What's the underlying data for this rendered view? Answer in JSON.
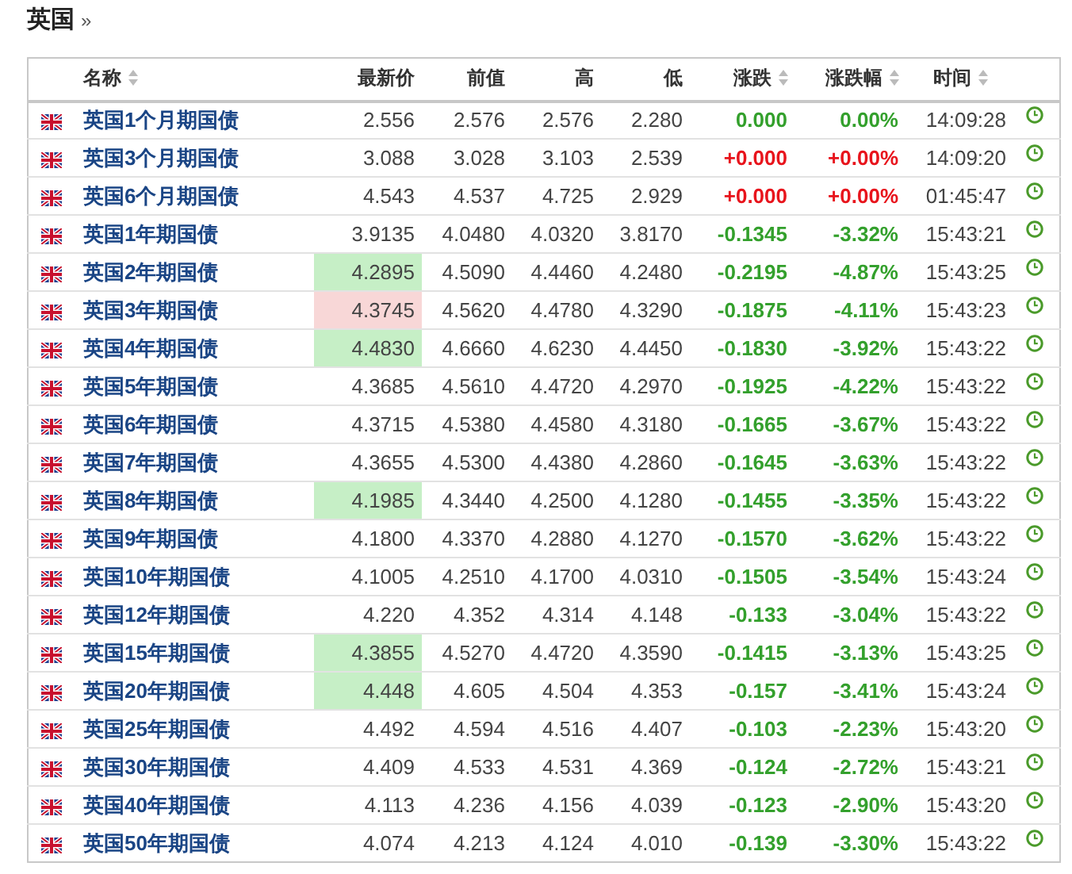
{
  "heading": {
    "title": "英国",
    "more": "»"
  },
  "table": {
    "columns": [
      {
        "label": "名称",
        "sortable": true
      },
      {
        "label": "最新价",
        "sortable": false
      },
      {
        "label": "前值",
        "sortable": false
      },
      {
        "label": "高",
        "sortable": false
      },
      {
        "label": "低",
        "sortable": false
      },
      {
        "label": "涨跌",
        "sortable": true
      },
      {
        "label": "涨跌幅",
        "sortable": true
      },
      {
        "label": "时间",
        "sortable": true
      }
    ],
    "rows": [
      {
        "name": "英国1个月期国债",
        "last": {
          "text": "2.556",
          "highlighted": false
        },
        "prev": "2.576",
        "high": "2.576",
        "low": "2.280",
        "change": "0.000",
        "change_pct": "0.00%",
        "time": "14:09:28",
        "color": "#33a02c"
      },
      {
        "name": "英国3个月期国债",
        "last": {
          "text": "3.088",
          "highlighted": false
        },
        "prev": "3.028",
        "high": "3.103",
        "low": "2.539",
        "change": "+0.000",
        "change_pct": "+0.00%",
        "time": "14:09:20",
        "color": "#e8141c"
      },
      {
        "name": "英国6个月期国债",
        "last": {
          "text": "4.543",
          "highlighted": false
        },
        "prev": "4.537",
        "high": "4.725",
        "low": "2.929",
        "change": "+0.000",
        "change_pct": "+0.00%",
        "time": "01:45:47",
        "color": "#e8141c"
      },
      {
        "name": "英国1年期国债",
        "last": {
          "text": "3.9135",
          "highlighted": false
        },
        "prev": "4.0480",
        "high": "4.0320",
        "low": "3.8170",
        "change": "-0.1345",
        "change_pct": "-3.32%",
        "time": "15:43:21",
        "color": "#33a02c"
      },
      {
        "name": "英国2年期国债",
        "last": {
          "text": "4.2895",
          "highlighted": true,
          "color": "#c6efc6"
        },
        "prev": "4.5090",
        "high": "4.4460",
        "low": "4.2480",
        "change": "-0.2195",
        "change_pct": "-4.87%",
        "time": "15:43:25",
        "color": "#33a02c"
      },
      {
        "name": "英国3年期国债",
        "last": {
          "text": "4.3745",
          "highlighted": true,
          "color": "#f8d7d7"
        },
        "prev": "4.5620",
        "high": "4.4780",
        "low": "4.3290",
        "change": "-0.1875",
        "change_pct": "-4.11%",
        "time": "15:43:23",
        "color": "#33a02c"
      },
      {
        "name": "英国4年期国债",
        "last": {
          "text": "4.4830",
          "highlighted": true,
          "color": "#c6efc6"
        },
        "prev": "4.6660",
        "high": "4.6230",
        "low": "4.4450",
        "change": "-0.1830",
        "change_pct": "-3.92%",
        "time": "15:43:22",
        "color": "#33a02c"
      },
      {
        "name": "英国5年期国债",
        "last": {
          "text": "4.3685",
          "highlighted": false
        },
        "prev": "4.5610",
        "high": "4.4720",
        "low": "4.2970",
        "change": "-0.1925",
        "change_pct": "-4.22%",
        "time": "15:43:22",
        "color": "#33a02c"
      },
      {
        "name": "英国6年期国债",
        "last": {
          "text": "4.3715",
          "highlighted": false
        },
        "prev": "4.5380",
        "high": "4.4580",
        "low": "4.3180",
        "change": "-0.1665",
        "change_pct": "-3.67%",
        "time": "15:43:22",
        "color": "#33a02c"
      },
      {
        "name": "英国7年期国债",
        "last": {
          "text": "4.3655",
          "highlighted": false
        },
        "prev": "4.5300",
        "high": "4.4380",
        "low": "4.2860",
        "change": "-0.1645",
        "change_pct": "-3.63%",
        "time": "15:43:22",
        "color": "#33a02c"
      },
      {
        "name": "英国8年期国债",
        "last": {
          "text": "4.1985",
          "highlighted": true,
          "color": "#c6efc6"
        },
        "prev": "4.3440",
        "high": "4.2500",
        "low": "4.1280",
        "change": "-0.1455",
        "change_pct": "-3.35%",
        "time": "15:43:22",
        "color": "#33a02c"
      },
      {
        "name": "英国9年期国债",
        "last": {
          "text": "4.1800",
          "highlighted": false
        },
        "prev": "4.3370",
        "high": "4.2880",
        "low": "4.1270",
        "change": "-0.1570",
        "change_pct": "-3.62%",
        "time": "15:43:22",
        "color": "#33a02c"
      },
      {
        "name": "英国10年期国债",
        "last": {
          "text": "4.1005",
          "highlighted": false
        },
        "prev": "4.2510",
        "high": "4.1700",
        "low": "4.0310",
        "change": "-0.1505",
        "change_pct": "-3.54%",
        "time": "15:43:24",
        "color": "#33a02c"
      },
      {
        "name": "英国12年期国债",
        "last": {
          "text": "4.220",
          "highlighted": false
        },
        "prev": "4.352",
        "high": "4.314",
        "low": "4.148",
        "change": "-0.133",
        "change_pct": "-3.04%",
        "time": "15:43:22",
        "color": "#33a02c"
      },
      {
        "name": "英国15年期国债",
        "last": {
          "text": "4.3855",
          "highlighted": true,
          "color": "#c6efc6"
        },
        "prev": "4.5270",
        "high": "4.4720",
        "low": "4.3590",
        "change": "-0.1415",
        "change_pct": "-3.13%",
        "time": "15:43:25",
        "color": "#33a02c"
      },
      {
        "name": "英国20年期国债",
        "last": {
          "text": "4.448",
          "highlighted": true,
          "color": "#c6efc6"
        },
        "prev": "4.605",
        "high": "4.504",
        "low": "4.353",
        "change": "-0.157",
        "change_pct": "-3.41%",
        "time": "15:43:24",
        "color": "#33a02c"
      },
      {
        "name": "英国25年期国债",
        "last": {
          "text": "4.492",
          "highlighted": false
        },
        "prev": "4.594",
        "high": "4.516",
        "low": "4.407",
        "change": "-0.103",
        "change_pct": "-2.23%",
        "time": "15:43:20",
        "color": "#33a02c"
      },
      {
        "name": "英国30年期国债",
        "last": {
          "text": "4.409",
          "highlighted": false
        },
        "prev": "4.533",
        "high": "4.531",
        "low": "4.369",
        "change": "-0.124",
        "change_pct": "-2.72%",
        "time": "15:43:21",
        "color": "#33a02c"
      },
      {
        "name": "英国40年期国债",
        "last": {
          "text": "4.113",
          "highlighted": false
        },
        "prev": "4.236",
        "high": "4.156",
        "low": "4.039",
        "change": "-0.123",
        "change_pct": "-2.90%",
        "time": "15:43:20",
        "color": "#33a02c"
      },
      {
        "name": "英国50年期国债",
        "last": {
          "text": "4.074",
          "highlighted": false
        },
        "prev": "4.213",
        "high": "4.124",
        "low": "4.010",
        "change": "-0.139",
        "change_pct": "-3.30%",
        "time": "15:43:22",
        "color": "#33a02c"
      }
    ]
  }
}
